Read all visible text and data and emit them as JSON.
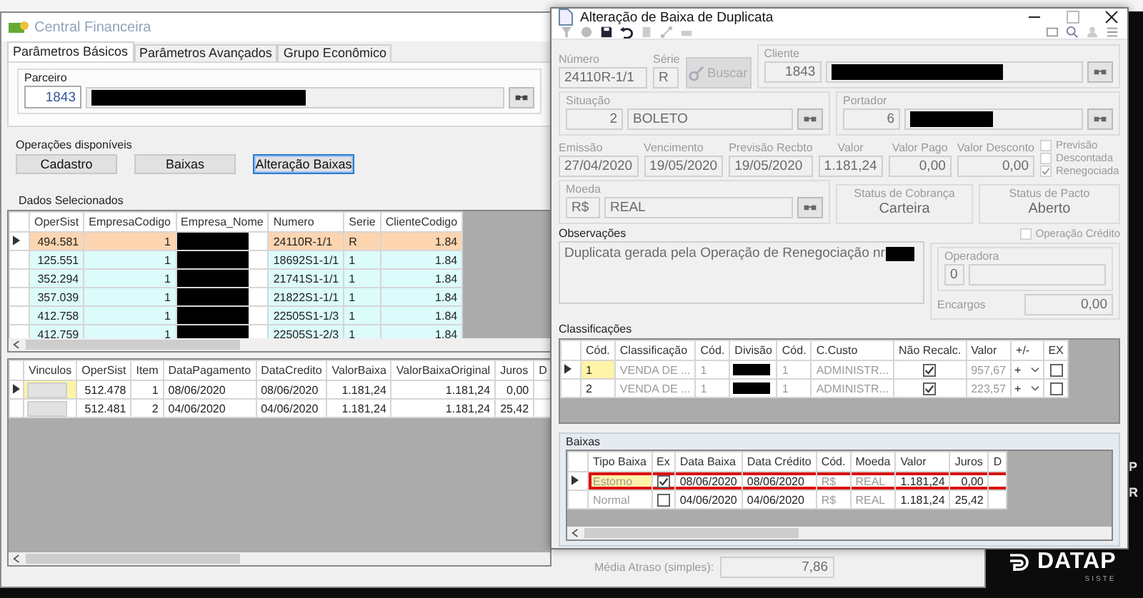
{
  "main_window": {
    "title": "Central Financeira",
    "tabs": [
      {
        "label": "Parâmetros Básicos",
        "selected": true
      },
      {
        "label": "Parâmetros Avançados",
        "selected": false
      },
      {
        "label": "Grupo Econômico",
        "selected": false
      }
    ],
    "partner": {
      "label": "Parceiro",
      "code": "1843"
    },
    "operations": {
      "label": "Operações disponíveis",
      "buttons": [
        {
          "label": "Cadastro",
          "selected": false
        },
        {
          "label": "Baixas",
          "selected": false
        },
        {
          "label": "Alteração Baixas",
          "selected": true
        }
      ]
    },
    "selected_data": {
      "label": "Dados Selecionados",
      "columns": [
        {
          "label": "OperSist",
          "kind": "number"
        },
        {
          "label": "EmpresaCodigo",
          "kind": "number"
        },
        {
          "label": "Empresa_Nome",
          "kind": "redacted"
        },
        {
          "label": "Numero",
          "kind": "text"
        },
        {
          "label": "Serie",
          "kind": "text"
        },
        {
          "label": "ClienteCodigo",
          "kind": "number"
        }
      ],
      "rows": [
        {
          "selected": true,
          "cells": [
            "494.581",
            "1",
            null,
            "24110R-1/1",
            "R",
            "1.84"
          ]
        },
        {
          "selected": false,
          "cells": [
            "125.551",
            "1",
            null,
            "18692S1-1/1",
            "1",
            "1.84"
          ]
        },
        {
          "selected": false,
          "cells": [
            "352.294",
            "1",
            null,
            "21741S1-1/1",
            "1",
            "1.84"
          ]
        },
        {
          "selected": false,
          "cells": [
            "357.039",
            "1",
            null,
            "21822S1-1/1",
            "1",
            "1.84"
          ]
        },
        {
          "selected": false,
          "cells": [
            "412.758",
            "1",
            null,
            "22505S1-1/3",
            "1",
            "1.84"
          ]
        },
        {
          "selected": false,
          "cells": [
            "412.759",
            "1",
            null,
            "22505S1-2/3",
            "1",
            "1.84"
          ]
        }
      ]
    },
    "payments": {
      "columns": [
        {
          "label": "Vinculos",
          "kind": "button"
        },
        {
          "label": "OperSist",
          "kind": "number"
        },
        {
          "label": "Item",
          "kind": "number"
        },
        {
          "label": "DataPagamento",
          "kind": "text"
        },
        {
          "label": "DataCredito",
          "kind": "text"
        },
        {
          "label": "ValorBaixa",
          "kind": "number"
        },
        {
          "label": "ValorBaixaOriginal",
          "kind": "number"
        },
        {
          "label": "Juros",
          "kind": "number"
        },
        {
          "label": "D",
          "kind": "text"
        }
      ],
      "rows": [
        {
          "selected": true,
          "cells": [
            null,
            "512.478",
            "1",
            "08/06/2020",
            "08/06/2020",
            "1.181,24",
            "1.181,24",
            "0,00"
          ]
        },
        {
          "selected": false,
          "cells": [
            null,
            "512.481",
            "2",
            "04/06/2020",
            "04/06/2020",
            "1.181,24",
            "1.181,24",
            "25,42"
          ]
        }
      ]
    },
    "average_delay": {
      "label": "Média Atraso (simples):",
      "value": "7,86"
    }
  },
  "dialog": {
    "title": "Alteração de Baixa de Duplicata",
    "numero": {
      "label": "Número",
      "value": "24110R-1/1"
    },
    "serie": {
      "label": "Série",
      "value": "R"
    },
    "search_button": {
      "label": "Buscar",
      "disabled": true
    },
    "cliente": {
      "label": "Cliente",
      "code": "1843"
    },
    "situacao": {
      "label": "Situação",
      "code": "2",
      "name": "BOLETO"
    },
    "portador": {
      "label": "Portador",
      "code": "6"
    },
    "values": [
      {
        "label": "Emissão",
        "value": "27/04/2020",
        "kind": "date"
      },
      {
        "label": "Vencimento",
        "value": "19/05/2020",
        "kind": "date"
      },
      {
        "label": "Previsão Recbto",
        "value": "19/05/2020",
        "kind": "date"
      },
      {
        "label": "Valor",
        "value": "1.181,24",
        "kind": "amount"
      },
      {
        "label": "Valor Pago",
        "value": "0,00",
        "kind": "amount"
      },
      {
        "label": "Valor Desconto",
        "value": "0,00",
        "kind": "amount"
      }
    ],
    "flags": [
      {
        "label": "Previsão",
        "checked": false
      },
      {
        "label": "Descontada",
        "checked": false
      },
      {
        "label": "Renegociada",
        "checked": true
      }
    ],
    "moeda": {
      "label": "Moeda",
      "code": "R$",
      "name": "REAL"
    },
    "statuses": [
      {
        "label": "Status de Cobrança",
        "value": "Carteira"
      },
      {
        "label": "Status de Pacto",
        "value": "Aberto"
      }
    ],
    "observacoes": {
      "label": "Observações",
      "text": "Duplicata gerada pela Operação de Renegociação nr"
    },
    "operacao_credito": {
      "label": "Operação Crédito",
      "checked": false
    },
    "operadora": {
      "label": "Operadora",
      "code": "0"
    },
    "encargos": {
      "label": "Encargos",
      "value": "0,00"
    },
    "classificacoes": {
      "label": "Classificações",
      "columns": [
        {
          "label": "Cód.",
          "kind": "text",
          "disabled": false
        },
        {
          "label": "Classificação",
          "kind": "text",
          "disabled": true
        },
        {
          "label": "Cód.",
          "kind": "text",
          "disabled": true
        },
        {
          "label": "Divisão",
          "kind": "redacted",
          "disabled": false
        },
        {
          "label": "Cód.",
          "kind": "text",
          "disabled": true
        },
        {
          "label": "C.Custo",
          "kind": "text",
          "disabled": true
        },
        {
          "label": "Não Recalc.",
          "kind": "check",
          "disabled": false
        },
        {
          "label": "Valor",
          "kind": "number",
          "disabled": true
        },
        {
          "label": "+/-",
          "kind": "sign",
          "disabled": false
        },
        {
          "label": "EX",
          "kind": "check",
          "disabled": false
        }
      ],
      "rows": [
        {
          "selected": true,
          "cells": [
            "1",
            "VENDA DE ...",
            "1",
            null,
            "1",
            "ADMINISTR...",
            true,
            "957,67",
            "+",
            false
          ]
        },
        {
          "selected": false,
          "cells": [
            "2",
            "VENDA DE ...",
            "1",
            null,
            "1",
            "ADMINISTR...",
            true,
            "223,57",
            "+",
            false
          ]
        }
      ]
    },
    "baixas": {
      "label": "Baixas",
      "columns": [
        {
          "label": "Tipo Baixa",
          "kind": "text",
          "disabled": true
        },
        {
          "label": "Ex",
          "kind": "check",
          "disabled": false
        },
        {
          "label": "Data Baixa",
          "kind": "text",
          "disabled": false
        },
        {
          "label": "Data Crédito",
          "kind": "text",
          "disabled": false
        },
        {
          "label": "Cód.",
          "kind": "text",
          "disabled": true
        },
        {
          "label": "Moeda",
          "kind": "text",
          "disabled": true
        },
        {
          "label": "Valor",
          "kind": "number",
          "disabled": false
        },
        {
          "label": "Juros",
          "kind": "number",
          "disabled": false
        },
        {
          "label": "D",
          "kind": "text",
          "disabled": false
        }
      ],
      "rows": [
        {
          "selected": true,
          "highlighted": true,
          "cells": [
            "Estorno",
            true,
            "08/06/2020",
            "08/06/2020",
            "R$",
            "REAL",
            "1.181,24",
            "0,00"
          ]
        },
        {
          "selected": false,
          "highlighted": false,
          "cells": [
            "Normal",
            false,
            "04/06/2020",
            "04/06/2020",
            "R$",
            "REAL",
            "1.181,24",
            "25,42"
          ]
        }
      ]
    }
  },
  "brand": {
    "name": "DATAP",
    "tagline": "SISTE",
    "letters": [
      "P",
      "R"
    ]
  }
}
